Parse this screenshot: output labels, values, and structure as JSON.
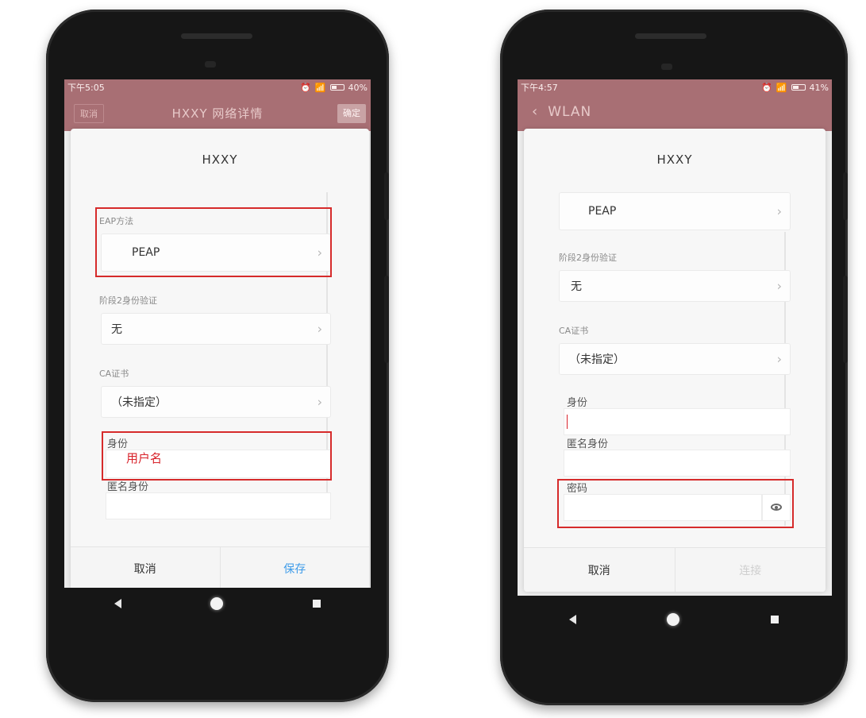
{
  "left": {
    "status": {
      "time": "下午5:05",
      "battery": "40%"
    },
    "titlebar": {
      "cancel": "取消",
      "title": "HXXY 网络详情",
      "confirm": "确定"
    },
    "dialog": {
      "title": "HXXY",
      "eap_label": "EAP方法",
      "eap_value": "PEAP",
      "phase2_label": "阶段2身份验证",
      "phase2_value": "无",
      "ca_label": "CA证书",
      "ca_value": "（未指定）",
      "identity_label": "身份",
      "identity_annotation": "用户名",
      "anonymous_label": "匿名身份",
      "cancel": "取消",
      "save": "保存"
    }
  },
  "right": {
    "status": {
      "time": "下午4:57",
      "battery": "41%"
    },
    "titlebar": {
      "back": "WLAN"
    },
    "dialog": {
      "title": "HXXY",
      "eap_value": "PEAP",
      "phase2_label": "阶段2身份验证",
      "phase2_value": "无",
      "ca_label": "CA证书",
      "ca_value": "（未指定）",
      "identity_label": "身份",
      "anonymous_label": "匿名身份",
      "password_label": "密码",
      "cancel": "取消",
      "connect": "连接"
    }
  },
  "colors": {
    "accent": "#a86f74",
    "highlight": "#d62b2b",
    "link": "#3d9be9"
  },
  "icons": [
    "alarm-icon",
    "wifi-icon",
    "signal-icon",
    "battery-icon",
    "chevron-right-icon",
    "back-chevron-icon",
    "eye-icon",
    "nav-back-icon",
    "nav-home-icon",
    "nav-recent-icon"
  ]
}
